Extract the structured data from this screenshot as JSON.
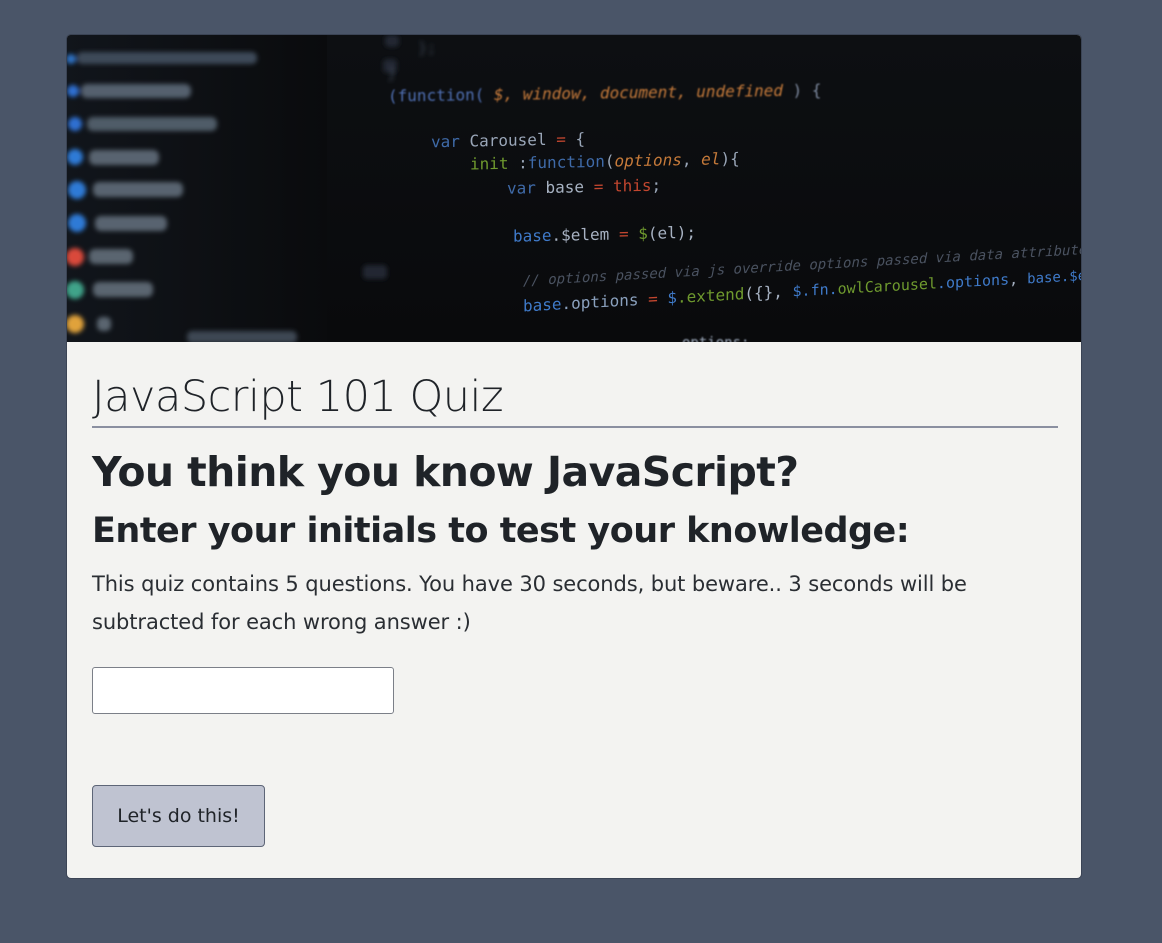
{
  "colors": {
    "page_background": "#4a5568",
    "card_background": "#f3f3f1",
    "button_background": "#bfc3d1",
    "title_rule": "#8a8fa0"
  },
  "hero": {
    "image_description_icon": "code-editor-image",
    "file_tree": [
      "bootstrap & 3.3.7.min.css",
      "flexslider.css",
      "owl.carousel.css",
      "README",
      "readme.txt",
      "style.css",
      "fonts",
      "images",
      "js"
    ],
    "code_lines": [
      "(function( $, window, document, undefined ) {",
      "var Carousel = {",
      "init :function(options, el){",
      "var base = this;",
      "base.$elem = $(el);",
      "// options passed via js override options passed via data attributes",
      "base.options = $.extend({}, $.fn.owlCarousel.options, base.$elem.data(), options);",
      "options;"
    ]
  },
  "quiz": {
    "title": "JavaScript 101 Quiz",
    "headline": "You think you know JavaScript?",
    "subheadline": "Enter your initials to test your knowledge:",
    "intro": "This quiz contains 5 questions. You have 30 seconds, but beware.. 3 seconds will be subtracted for each wrong answer :)",
    "initials_value": "",
    "initials_placeholder": "",
    "start_label": "Let's do this!"
  }
}
